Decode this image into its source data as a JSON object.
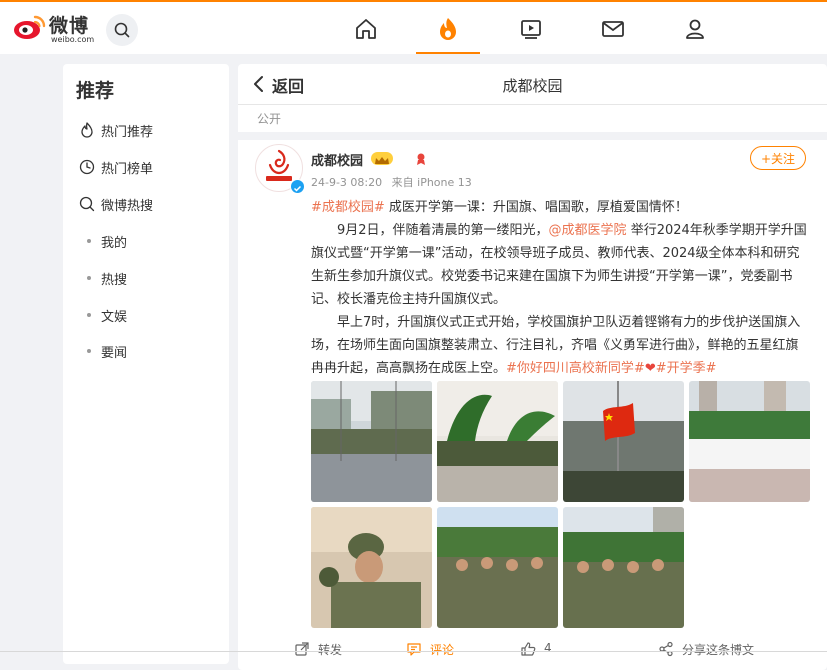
{
  "brand": {
    "name": "微博",
    "domain": "weibo.com"
  },
  "colors": {
    "accent": "#ff8200",
    "link": "#eb7350",
    "verified": "#1da1f2"
  },
  "nav": {
    "items": [
      {
        "name": "home",
        "icon": "home-icon"
      },
      {
        "name": "hot",
        "icon": "flame-icon",
        "active": true
      },
      {
        "name": "video",
        "icon": "video-icon"
      },
      {
        "name": "messages",
        "icon": "mail-icon"
      },
      {
        "name": "profile",
        "icon": "user-icon"
      }
    ]
  },
  "sidebar": {
    "title": "推荐",
    "items": [
      {
        "label": "热门推荐",
        "icon": "flame-outline-icon"
      },
      {
        "label": "热门榜单",
        "icon": "ranking-icon"
      },
      {
        "label": "微博热搜",
        "icon": "search-hot-icon"
      },
      {
        "label": "我的",
        "icon": "dot"
      },
      {
        "label": "热搜",
        "icon": "dot"
      },
      {
        "label": "文娱",
        "icon": "dot"
      },
      {
        "label": "要闻",
        "icon": "dot"
      }
    ]
  },
  "main": {
    "back_label": "返回",
    "page_title": "成都校园",
    "visibility": "公开"
  },
  "post": {
    "author": "成都校园",
    "avatar_text": "成都校园",
    "date": "24-9-3 08:20",
    "source": "来自 iPhone 13",
    "follow_label": "+关注",
    "tag1": "#成都校园#",
    "headline": " 成医开学第一课：升国旗、唱国歌，厚植爱国情怀！",
    "p1_a": "9月2日，伴随着清晨的第一缕阳光，",
    "mention": "@成都医学院",
    "p1_b": " 举行2024年秋季学期开学升国旗仪式暨“开学第一课”活动，在校领导班子成员、教师代表、2024级全体本科和研究生新生参加升旗仪式。校党委书记来建在国旗下为师生讲授“开学第一课”，党委副书记、校长潘克俭主持升国旗仪式。",
    "p2": "早上7时，升国旗仪式正式开始，学校国旗护卫队迈着铿锵有力的步伐护送国旗入场，在场师生面向国旗整装肃立、行注目礼，齐唱《义勇军进行曲》，鲜艳的五星红旗冉冉升起，高高飘扬在成医上空。",
    "tag2": "#你好四川高校新同学#",
    "heart": "❤",
    "tag3": "#开学季#",
    "photo_count": 7
  },
  "actions": {
    "repost": "转发",
    "comment": "评论",
    "like_count": "4",
    "share": "分享这条博文"
  }
}
